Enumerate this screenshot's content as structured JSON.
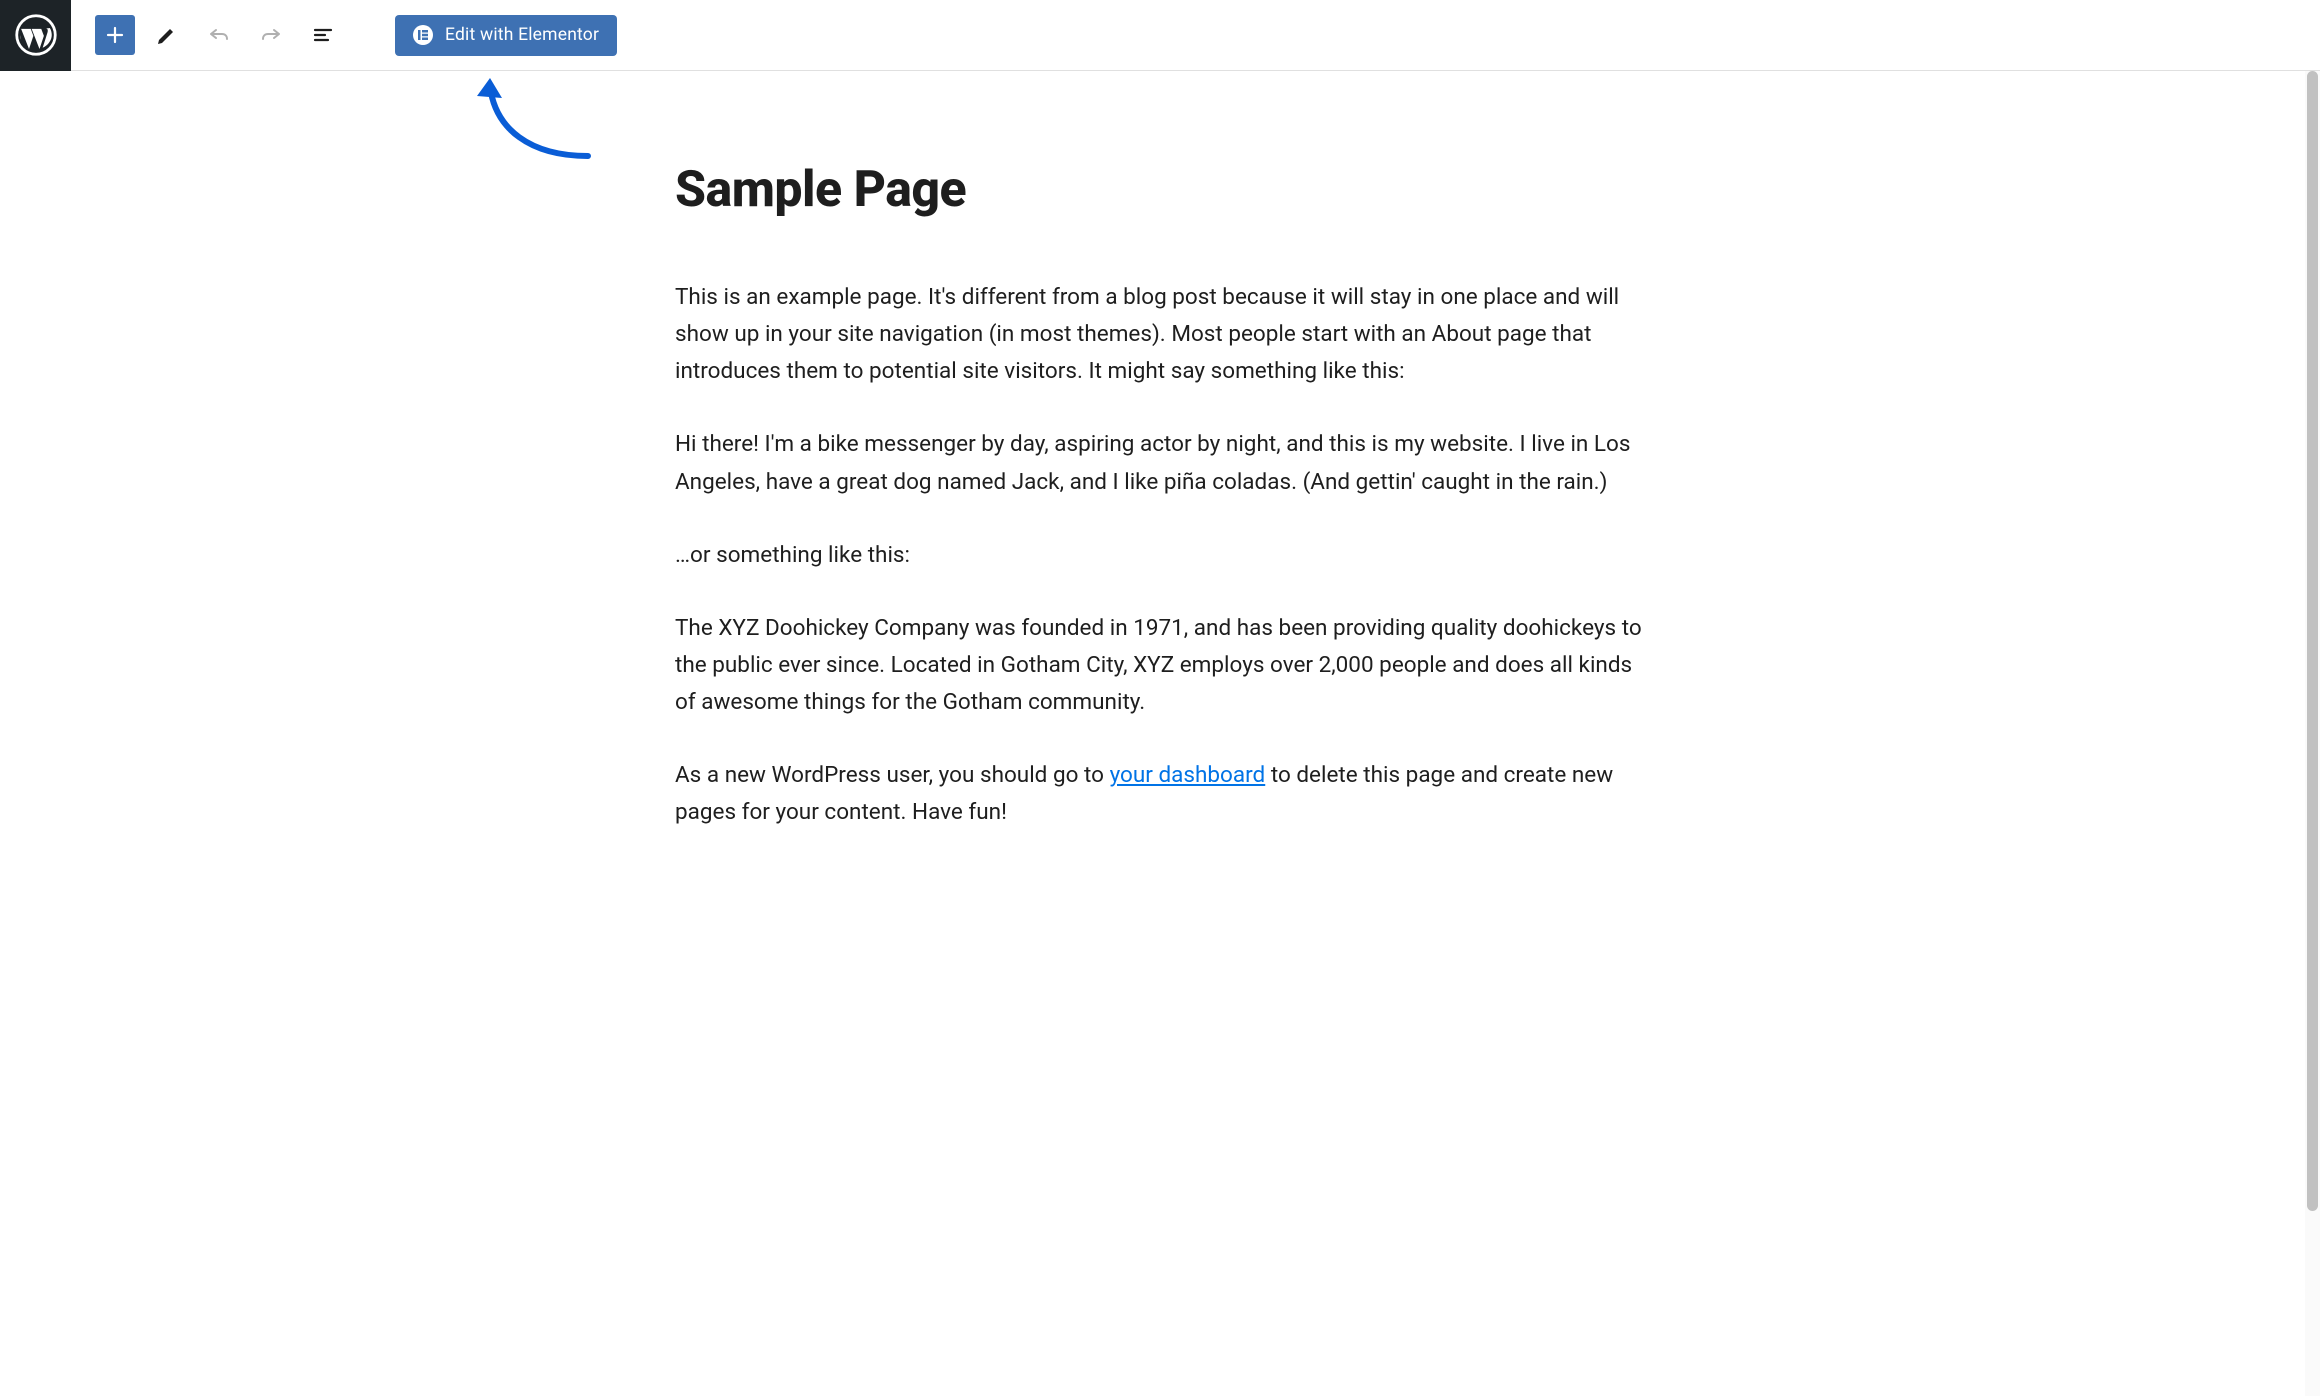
{
  "toolbar": {
    "elementor_button_label": "Edit with Elementor"
  },
  "page": {
    "title": "Sample Page",
    "paragraphs": [
      "This is an example page. It's different from a blog post because it will stay in one place and will show up in your site navigation (in most themes). Most people start with an About page that introduces them to potential site visitors. It might say something like this:",
      "Hi there! I'm a bike messenger by day, aspiring actor by night, and this is my website. I live in Los Angeles, have a great dog named Jack, and I like piña coladas. (And gettin' caught in the rain.)",
      "…or something like this:",
      "The XYZ Doohickey Company was founded in 1971, and has been providing quality doohickeys to the public ever since. Located in Gotham City, XYZ employs over 2,000 people and does all kinds of awesome things for the Gotham community."
    ],
    "last_paragraph": {
      "before_link": "As a new WordPress user, you should go to ",
      "link_text": "your dashboard",
      "after_link": " to delete this page and create new pages for your content. Have fun!"
    }
  }
}
